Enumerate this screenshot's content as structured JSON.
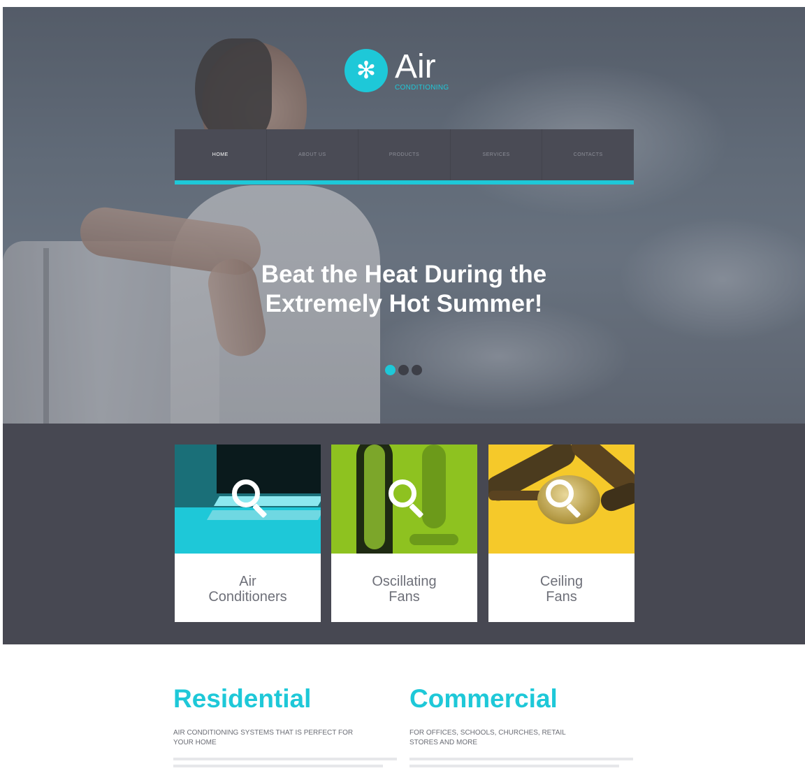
{
  "brand": {
    "badge_glyph": "✻",
    "name": "Air",
    "tagline": "CONDITIONING",
    "accent_color": "#1ec8d8"
  },
  "nav": {
    "items": [
      {
        "label": "HOME",
        "active": true
      },
      {
        "label": "ABOUT US",
        "active": false
      },
      {
        "label": "PRODUCTS",
        "active": false
      },
      {
        "label": "SERVICES",
        "active": false
      },
      {
        "label": "CONTACTS",
        "active": false
      }
    ]
  },
  "hero": {
    "headline_line1": "Beat the Heat During the",
    "headline_line2": "Extremely Hot Summer!",
    "slides": {
      "count": 3,
      "active_index": 0
    }
  },
  "products": [
    {
      "label_line1": "Air",
      "label_line2": "Conditioners",
      "color": "#1ec8d8"
    },
    {
      "label_line1": "Oscillating",
      "label_line2": "Fans",
      "color": "#8ec220"
    },
    {
      "label_line1": "Ceiling",
      "label_line2": "Fans",
      "color": "#f5c92a"
    }
  ],
  "services": [
    {
      "title": "Residential",
      "subtitle": "AIR CONDITIONING SYSTEMS THAT IS PERFECT FOR YOUR HOME"
    },
    {
      "title": "Commercial",
      "subtitle": "FOR OFFICES, SCHOOLS, CHURCHES, RETAIL STORES AND MORE"
    }
  ],
  "icons": {
    "product_card_icon": "magnifier-icon",
    "logo_icon": "snowflake-icon"
  }
}
